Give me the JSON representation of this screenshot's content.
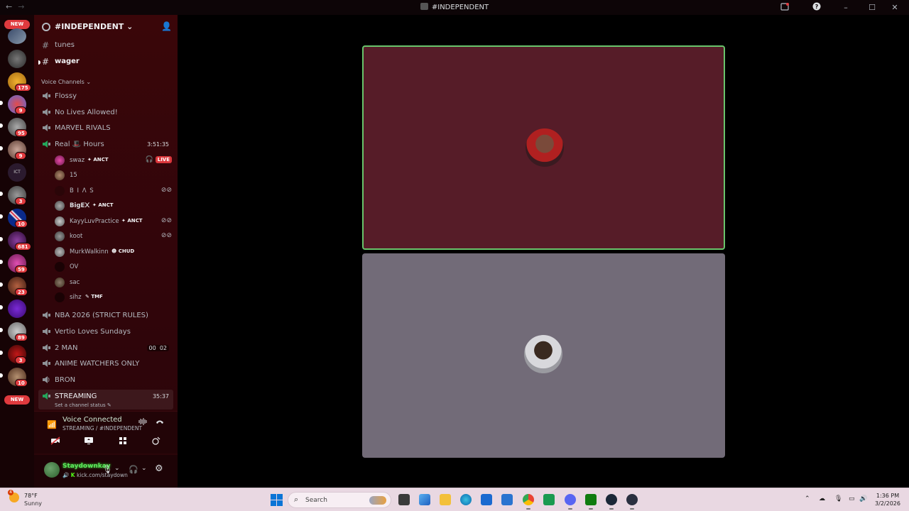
{
  "window": {
    "title": "#INDEPENDENT",
    "back": "←",
    "forward": "→"
  },
  "rail": {
    "new_label": "NEW",
    "badges": [
      "175",
      "9",
      "95",
      "9",
      "3",
      "10",
      "681",
      "59",
      "23",
      "89",
      "3",
      "10"
    ],
    "partial_label": "ICT"
  },
  "server": {
    "name": "#INDEPENDENT"
  },
  "channels": {
    "text": [
      {
        "name": "tunes"
      },
      {
        "name": "wager"
      }
    ],
    "category": "Voice Channels",
    "voice": [
      {
        "name": "Flossy"
      },
      {
        "name": "No Lives Allowed!"
      },
      {
        "name": "MARVEL RIVALS"
      },
      {
        "name": "Real 🎩 Hours",
        "timer": "3:51:35"
      },
      {
        "name": "NBA 2026 (STRICT RULES)"
      },
      {
        "name": "Vertio Loves Sundays"
      },
      {
        "name": "2 MAN",
        "timer": "00  02"
      },
      {
        "name": "ANIME WATCHERS ONLY"
      },
      {
        "name": "BRON"
      },
      {
        "name": "STREAMING",
        "timer": "35:37",
        "status": "Set a channel status"
      }
    ]
  },
  "voice_users": [
    {
      "name": "swaz",
      "tag": "ANCT",
      "live": "LIVE"
    },
    {
      "name": "15"
    },
    {
      "name": "B I Λ S"
    },
    {
      "name": "BigE᙭",
      "tag": "ANCT"
    },
    {
      "name": "KayyLuvPractice",
      "tag": "ANCT"
    },
    {
      "name": "koot"
    },
    {
      "name": "MurkWalkinn",
      "tag": "CHUD"
    },
    {
      "name": "OV"
    },
    {
      "name": "sac"
    },
    {
      "name": "sihz",
      "tag": "TMF"
    }
  ],
  "voice_panel": {
    "title": "Voice Connected",
    "subtitle": "STREAMING / #INDEPENDENT"
  },
  "user_panel": {
    "username": "Staydownkay",
    "status": "kick.com/staydown"
  },
  "taskbar": {
    "weather_temp": "78°F",
    "weather_cond": "Sunny",
    "weather_badge": "4",
    "search_placeholder": "Search",
    "time": "1:36 PM",
    "date": "3/2/2026"
  }
}
